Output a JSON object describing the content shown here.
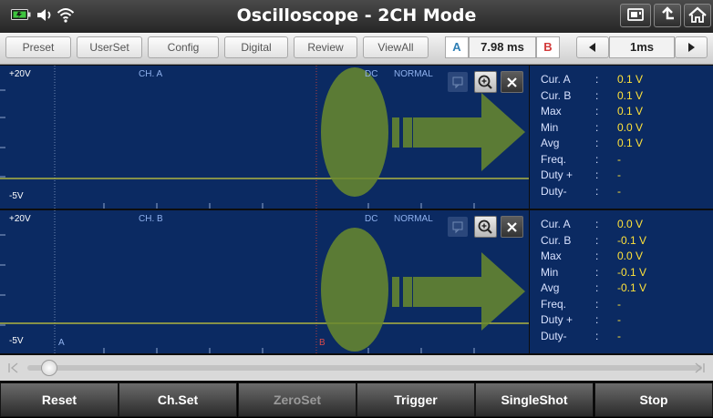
{
  "window": {
    "title": "Oscilloscope - 2CH Mode"
  },
  "status_icons": [
    "battery-icon",
    "volume-icon",
    "wifi-icon"
  ],
  "title_buttons": [
    "screenshot-icon",
    "upload-icon",
    "home-icon"
  ],
  "toolbar": {
    "buttons": [
      "Preset",
      "UserSet",
      "Config",
      "Digital",
      "Review",
      "ViewAll"
    ],
    "cursor_a_label": "A",
    "cursor_delta": "7.98 ms",
    "cursor_b_label": "B",
    "timebase": "1ms"
  },
  "channels": [
    {
      "top_scale": "+20V",
      "bottom_scale": "-5V",
      "name": "CH. A",
      "coupling": "DC",
      "mode": "NORMAL",
      "cursor_a": "",
      "cursor_b": "",
      "readouts": [
        {
          "label": "Cur. A",
          "value": "0.1 V"
        },
        {
          "label": "Cur. B",
          "value": "0.1 V"
        },
        {
          "label": "Max",
          "value": "0.1 V"
        },
        {
          "label": "Min",
          "value": "0.0 V"
        },
        {
          "label": "Avg",
          "value": "0.1 V"
        },
        {
          "label": "Freq.",
          "value": "-"
        },
        {
          "label": "Duty +",
          "value": "-"
        },
        {
          "label": "Duty-",
          "value": "-"
        }
      ]
    },
    {
      "top_scale": "+20V",
      "bottom_scale": "-5V",
      "name": "CH. B",
      "coupling": "DC",
      "mode": "NORMAL",
      "cursor_a": "A",
      "cursor_b": "B",
      "readouts": [
        {
          "label": "Cur. A",
          "value": "0.0 V"
        },
        {
          "label": "Cur. B",
          "value": "-0.1 V"
        },
        {
          "label": "Max",
          "value": "0.0 V"
        },
        {
          "label": "Min",
          "value": "-0.1 V"
        },
        {
          "label": "Avg",
          "value": "-0.1 V"
        },
        {
          "label": "Freq.",
          "value": "-"
        },
        {
          "label": "Duty +",
          "value": "-"
        },
        {
          "label": "Duty-",
          "value": "-"
        }
      ]
    }
  ],
  "scrollbar": {
    "position": 0.02
  },
  "bottom_bar": [
    {
      "label": "Reset",
      "enabled": true
    },
    {
      "label": "Ch.Set",
      "enabled": true
    },
    {
      "label": "ZeroSet",
      "enabled": false
    },
    {
      "label": "Trigger",
      "enabled": true
    },
    {
      "label": "SingleShot",
      "enabled": true
    },
    {
      "label": "Stop",
      "enabled": true
    }
  ],
  "colors": {
    "plot_bg": "#0b2a62",
    "trace": "#cfcf3a",
    "readout_value": "#ffe23a",
    "overlay": "#6a8a2e"
  }
}
